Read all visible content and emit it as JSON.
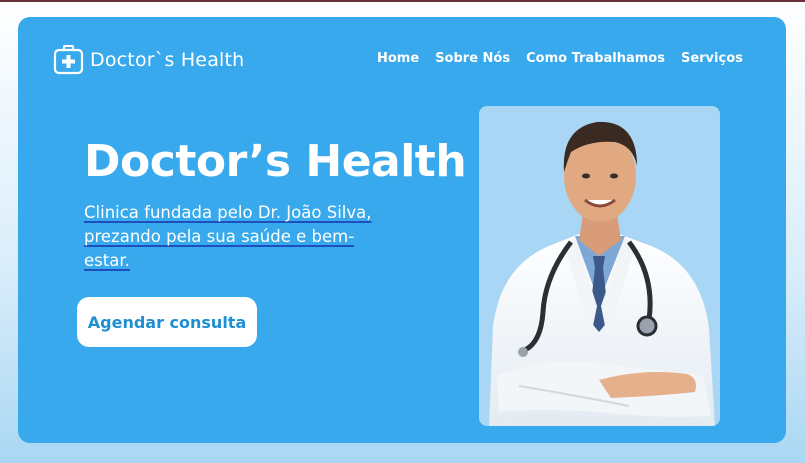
{
  "brand": {
    "name": "Doctor`s Health"
  },
  "nav": {
    "items": [
      {
        "label": "Home"
      },
      {
        "label": "Sobre Nós"
      },
      {
        "label": "Como Trabalhamos"
      },
      {
        "label": "Serviços"
      }
    ]
  },
  "hero": {
    "title": "Doctor’s Health",
    "description": "Clinica fundada pelo Dr. João Silva, prezando pela sua saúde e bem-estar.",
    "cta_label": "Agendar consulta"
  },
  "colors": {
    "hero_background": "#37a9ec",
    "cta_text": "#1e8fd2",
    "photo_background": "#a9d6f4"
  }
}
